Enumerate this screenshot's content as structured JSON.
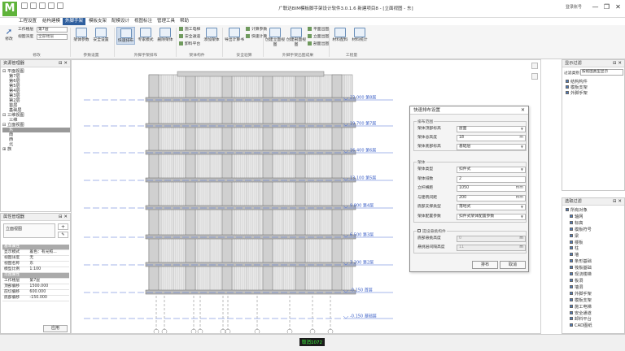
{
  "app": {
    "title": "广联达BIM模板脚手架设计软件3.0.1.6 新建项目8 - [立面视图 - 东]",
    "tabs": [
      "工程设置",
      "结构建模",
      "外脚手架",
      "模板支架",
      "配模设计",
      "视图标注",
      "管理工具",
      "帮助"
    ],
    "active_tab": 2,
    "window_controls": [
      "—",
      "❐",
      "✕"
    ],
    "user": "登录账号"
  },
  "ribbon": {
    "select_group": {
      "select_label": "修改",
      "floor_label": "工作楼层",
      "floor_value": "第7层",
      "view_label": "视图深度",
      "view_value": "全部楼层",
      "group_label": "修改"
    },
    "params_group": {
      "btn1": "架体参数",
      "btn2": "安全设置",
      "group_label": "参数设置"
    },
    "layout_group": {
      "btn1": "快速排布",
      "btn2": "专家模式",
      "btn3": "删除架体",
      "group_label": "外脚手架排布"
    },
    "struct_group": {
      "s1": "施工电梯",
      "s2": "安全通道",
      "s3": "卸料平台",
      "btn": "添加架体",
      "group_label": "架体构件"
    },
    "safety_group": {
      "btn": "导出计算书",
      "s1": "计算参数",
      "s2": "快速计算",
      "group_label": "安全验算"
    },
    "draw_group": {
      "btn1": "创建立面视图",
      "btn2": "创建剖面视图",
      "s1": "平面出图",
      "s2": "立面出图",
      "s3": "剖面出图",
      "group_label": "外脚手架出图成果"
    },
    "qty_group": {
      "btn1": "材料配料",
      "btn2": "材料统计",
      "group_label": "工程量"
    }
  },
  "resource_panel": {
    "title": "资源管理器",
    "items": [
      {
        "text": "⊟ 平面视图",
        "indent": 0,
        "selected": false
      },
      {
        "text": "第7层",
        "indent": 2,
        "selected": false
      },
      {
        "text": "第6层",
        "indent": 2,
        "selected": false
      },
      {
        "text": "第5层",
        "indent": 2,
        "selected": false
      },
      {
        "text": "第4层",
        "indent": 2,
        "selected": false
      },
      {
        "text": "第3层",
        "indent": 2,
        "selected": false
      },
      {
        "text": "第2层",
        "indent": 2,
        "selected": false
      },
      {
        "text": "首层",
        "indent": 2,
        "selected": false
      },
      {
        "text": "基础层",
        "indent": 2,
        "selected": false
      },
      {
        "text": "⊟ 三维视图",
        "indent": 0,
        "selected": false
      },
      {
        "text": "三维",
        "indent": 2,
        "selected": false
      },
      {
        "text": "⊟ 立面视图",
        "indent": 0,
        "selected": false
      },
      {
        "text": "东",
        "indent": 2,
        "selected": true
      },
      {
        "text": "南",
        "indent": 2,
        "selected": false
      },
      {
        "text": "西",
        "indent": 2,
        "selected": false
      },
      {
        "text": "北",
        "indent": 2,
        "selected": false
      },
      {
        "text": "⊞ 族",
        "indent": 0,
        "selected": false
      }
    ]
  },
  "property_panel": {
    "title": "属性管理器",
    "type_value": "立面视图",
    "rows": [
      {
        "k": "基本属性",
        "v": "",
        "sec": true
      },
      {
        "k": "显示模式",
        "v": "着色：有光照...",
        "sec": false
      },
      {
        "k": "视图详度",
        "v": "无",
        "sec": false
      },
      {
        "k": "视图名称",
        "v": "东",
        "sec": false
      },
      {
        "k": "模型比例",
        "v": "1:100",
        "sec": false
      },
      {
        "k": "范围属性",
        "v": "",
        "sec": true
      },
      {
        "k": "工作楼层",
        "v": "第7层",
        "sec": false
      },
      {
        "k": "顶部偏移",
        "v": "1500.000",
        "sec": false
      },
      {
        "k": "前切偏移",
        "v": "600.000",
        "sec": false
      },
      {
        "k": "底部偏移",
        "v": "-150.000",
        "sec": false
      }
    ],
    "apply_label": "应用"
  },
  "levels": [
    {
      "label": "23.000 第8层"
    },
    {
      "label": "19.700 第7层"
    },
    {
      "label": "16.400 第6层"
    },
    {
      "label": "13.100 第5层"
    },
    {
      "label": "9.800 第4层"
    },
    {
      "label": "6.500 第3层"
    },
    {
      "label": "3.200 第2层"
    },
    {
      "label": "-0.150 首层"
    },
    {
      "label": "-0.150 基础层"
    }
  ],
  "dialog": {
    "title": "快速排布设置",
    "group1_title": "排布范围",
    "group1": [
      {
        "label": "架体顶部标高",
        "value": "屋面",
        "unit": "",
        "dropdown": true,
        "disabled": false
      },
      {
        "label": "架体总高度",
        "value": "18",
        "unit": "m",
        "dropdown": false,
        "disabled": false
      },
      {
        "label": "架体底部标高",
        "value": "基础层",
        "unit": "",
        "dropdown": true,
        "disabled": false
      }
    ],
    "group2_title": "架体",
    "group2": [
      {
        "label": "架体类型",
        "value": "扣件式",
        "unit": "",
        "dropdown": true,
        "disabled": false
      },
      {
        "label": "架体排数",
        "value": "2",
        "unit": "",
        "dropdown": false,
        "disabled": false
      },
      {
        "label": "立杆横距",
        "value": "1050",
        "unit": "mm",
        "dropdown": false,
        "disabled": false
      },
      {
        "label": "与建筑间距",
        "value": "200",
        "unit": "mm",
        "dropdown": false,
        "disabled": false
      },
      {
        "label": "底部支撑类型",
        "value": "落地式",
        "unit": "",
        "dropdown": true,
        "disabled": false
      },
      {
        "label": "架体配置参数",
        "value": "扣件式架体配置参数",
        "unit": "",
        "dropdown": true,
        "disabled": false
      }
    ],
    "group3_check": "提设悬挑构件",
    "group3": [
      {
        "label": "底部悬挑高度",
        "value": "0",
        "unit": "m",
        "dropdown": false,
        "disabled": true
      },
      {
        "label": "悬挑层间隔高度",
        "value": "11",
        "unit": "m",
        "dropdown": false,
        "disabled": true
      }
    ],
    "ok_label": "排布",
    "cancel_label": "取消"
  },
  "display_filter": {
    "title": "显示过滤",
    "filter_label": "过滤类别",
    "filter_value": "按视图类型显示",
    "items": [
      "结构构件",
      "模板支架",
      "外脚手架"
    ]
  },
  "select_filter": {
    "title": "选取过滤",
    "items": [
      "所有对象",
      "轴网",
      "标高",
      "模板符号",
      "梁",
      "楼板",
      "柱",
      "墙",
      "条形基础",
      "筏板基础",
      "现浇楼梯",
      "板洞",
      "墙洞",
      "外脚手架",
      "模板支架",
      "施工电梯",
      "安全通道",
      "卸料平台",
      "CAD图纸"
    ]
  },
  "status": {
    "text": "取消1072"
  }
}
